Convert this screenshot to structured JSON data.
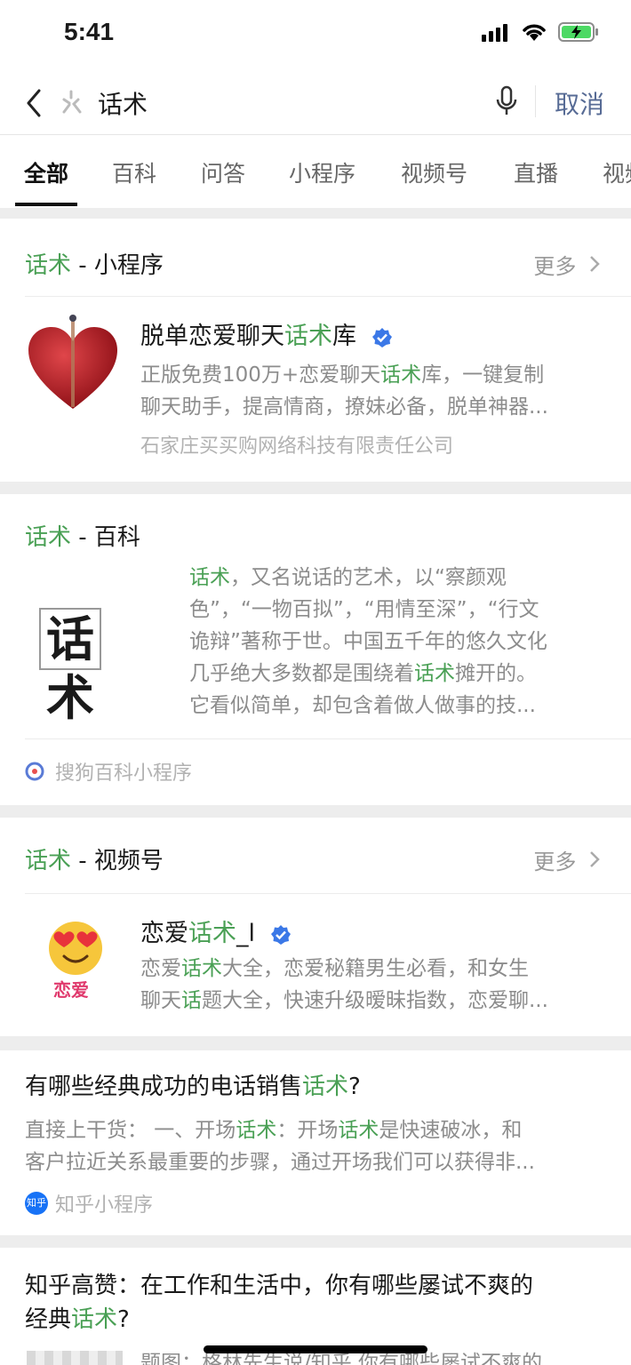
{
  "status_bar": {
    "time": "5:41"
  },
  "search": {
    "query": "话术",
    "cancel_label": "取消"
  },
  "tabs": [
    {
      "label": "全部",
      "active": true
    },
    {
      "label": "百科",
      "active": false
    },
    {
      "label": "问答",
      "active": false
    },
    {
      "label": "小程序",
      "active": false
    },
    {
      "label": "视频号",
      "active": false
    },
    {
      "label": "直播",
      "active": false
    },
    {
      "label": "视频",
      "active": false
    }
  ],
  "section_mini": {
    "keyword": "话术",
    "suffix": " - 小程序",
    "more_label": "更多",
    "item": {
      "name_before": "脱单恋爱聊天",
      "name_hl": "话术",
      "name_after": "库",
      "desc_line1_before": "正版免费100万+恋爱聊天",
      "desc_line1_hl": "话术",
      "desc_line1_after": "库，一键复制",
      "desc_line2": "聊天助手，提高情商，撩妹必备，脱单神器...",
      "company": "石家庄买买购网络科技有限责任公司"
    }
  },
  "section_baike": {
    "keyword": "话术",
    "suffix": " - 百科",
    "image_text": "话术",
    "l1_hl": "话术",
    "l1_rest": "，又名说话的艺术，以“察颜观",
    "l2": "色”，“一物百拟”，“用情至深”，“行文",
    "l3": "诡辩”著称于世。中国五千年的悠久文化",
    "l4_before": "几乎绝大多数都是围绕着",
    "l4_hl": "话术",
    "l4_after": "摊开的。",
    "l5": "它看似简单，却包含着做人做事的技...",
    "source": "搜狗百科小程序"
  },
  "section_video": {
    "keyword": "话术",
    "suffix": " - 视频号",
    "more_label": "更多",
    "item": {
      "name_before": "恋爱",
      "name_hl": "话术",
      "name_after": "_l",
      "avatar_text": "恋爱",
      "d1_before": "恋爱",
      "d1_hl": "话术",
      "d1_after": "大全，恋爱秘籍男生必看，和女生",
      "d2_before": "聊天",
      "d2_hl": "话",
      "d2_after": "题大全，快速升级暧昧指数，恋爱聊..."
    }
  },
  "qa1": {
    "title_before": "有哪些经典成功的电话销售",
    "title_hl": "话术",
    "title_after": "?",
    "l1_a": "直接上干货： 一、开场",
    "l1_hl1": "话术",
    "l1_b": "：开场",
    "l1_hl2": "话术",
    "l1_c": "是快速破冰，和",
    "l2": "客户拉近关系最重要的步骤，通过开场我们可以获得非...",
    "source": "知乎小程序",
    "badge": "知乎"
  },
  "qa2": {
    "title_line1": "知乎高赞：在工作和生活中，你有哪些屡试不爽的",
    "title_line2_before": "经典",
    "title_line2_hl": "话术",
    "title_line2_after": "?",
    "snippet": "题图：格林先生说/知乎 你有哪些屡试不爽的"
  },
  "colors": {
    "highlight": "#4aa055",
    "link": "#576b95",
    "verified": "#3b78e7"
  }
}
